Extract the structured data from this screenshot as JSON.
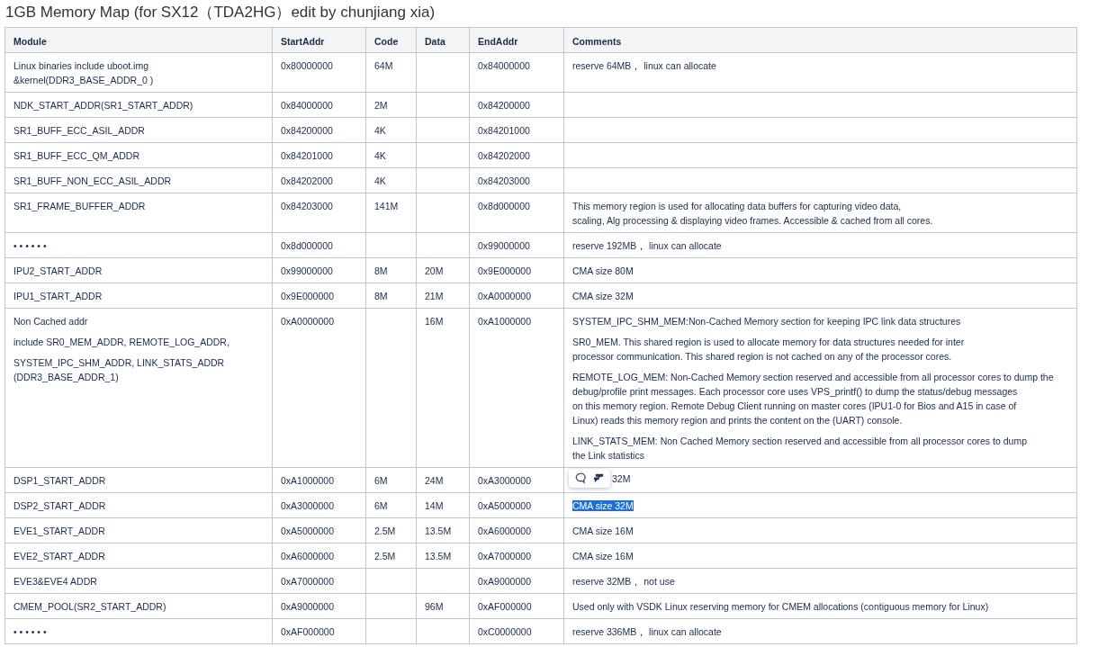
{
  "title": "1GB Memory Map (for SX12（TDA2HG）edit by chunjiang xia)",
  "table": {
    "columns": [
      "Module",
      "StartAddr",
      "Code",
      "Data",
      "EndAddr",
      "Comments"
    ],
    "rows": [
      {
        "module": [
          "Linux binaries include uboot.img\n&kernel(DDR3_BASE_ADDR_0 )"
        ],
        "start": "0x80000000",
        "code": "64M",
        "end": "0x84000000",
        "comment": [
          "reserve 64MB， linux can allocate"
        ],
        "comment_selected": false,
        "toolbar_shown": false
      },
      {
        "module": [
          "NDK_START_ADDR(SR1_START_ADDR)"
        ],
        "start": "0x84000000",
        "code": "2M",
        "end": "0x84200000",
        "comment_selected": false,
        "toolbar_shown": false
      },
      {
        "module": [
          "SR1_BUFF_ECC_ASIL_ADDR"
        ],
        "start": "0x84200000",
        "code": "4K",
        "end": "0x84201000",
        "comment_selected": false,
        "toolbar_shown": false
      },
      {
        "module": [
          "SR1_BUFF_ECC_QM_ADDR"
        ],
        "start": "0x84201000",
        "code": "4K",
        "end": "0x84202000",
        "comment_selected": false,
        "toolbar_shown": false
      },
      {
        "module": [
          "SR1_BUFF_NON_ECC_ASIL_ADDR"
        ],
        "start": "0x84202000",
        "code": "4K",
        "end": "0x84203000",
        "comment_selected": false,
        "toolbar_shown": false
      },
      {
        "module": [
          "SR1_FRAME_BUFFER_ADDR"
        ],
        "start": "0x84203000",
        "code": "141M",
        "end": "0x8d000000",
        "comment": [
          "This memory region is used for allocating data buffers for capturing video data,\nscaling, Alg processing & displaying video frames. Accessible & cached from all cores."
        ],
        "comment_selected": false,
        "toolbar_shown": false
      },
      {
        "module": [
          "• • • • • •"
        ],
        "start": "0x8d000000",
        "end": "0x99000000",
        "comment": [
          "reserve 192MB， linux can allocate"
        ],
        "comment_selected": false,
        "toolbar_shown": false
      },
      {
        "module": [
          "IPU2_START_ADDR"
        ],
        "start": "0x99000000",
        "code": "8M",
        "data": "20M",
        "end": "0x9E000000",
        "comment": [
          "CMA size 80M"
        ],
        "comment_selected": false,
        "toolbar_shown": false
      },
      {
        "module": [
          "IPU1_START_ADDR"
        ],
        "start": "0x9E000000",
        "code": "8M",
        "data": "21M",
        "end": "0xA0000000",
        "comment": [
          "CMA size 32M"
        ],
        "comment_selected": false,
        "toolbar_shown": false
      },
      {
        "module": [
          "Non Cached addr",
          "include SR0_MEM_ADDR, REMOTE_LOG_ADDR,",
          "SYSTEM_IPC_SHM_ADDR, LINK_STATS_ADDR\n(DDR3_BASE_ADDR_1)"
        ],
        "start": "0xA0000000",
        "data": "16M",
        "end": "0xA1000000",
        "comment": [
          "SYSTEM_IPC_SHM_MEM:Non-Cached Memory section for keeping IPC link data structures",
          "SR0_MEM. This shared region is used to allocate memory for data structures needed for inter\nprocessor communication. This shared region is not cached on any of the processor cores.",
          "REMOTE_LOG_MEM: Non-Cached Memory section reserved and accessible from all processor cores to dump the\ndebug/profile print messages. Each processor core uses VPS_printf() to dump the status/debug messages\non this memory region. Remote Debug Client running on master cores (IPU1-0 for Bios and A15 in case of\nLinux) reads this memory region and prints the content on the (UART) console.",
          "LINK_STATS_MEM: Non Cached Memory section reserved and accessible from all processor cores to dump\nthe Link statistics"
        ],
        "comment_selected": false,
        "toolbar_shown": false
      },
      {
        "module": [
          "DSP1_START_ADDR"
        ],
        "start": "0xA1000000",
        "code": "6M",
        "data": "24M",
        "end": "0xA3000000",
        "comment": [
          "32M"
        ],
        "comment_selected": false,
        "toolbar_shown": true
      },
      {
        "module": [
          "DSP2_START_ADDR"
        ],
        "start": "0xA3000000",
        "code": "6M",
        "data": "14M",
        "end": "0xA5000000",
        "comment": [
          "CMA size 32M"
        ],
        "comment_selected": true,
        "toolbar_shown": false
      },
      {
        "module": [
          "EVE1_START_ADDR"
        ],
        "start": "0xA5000000",
        "code": "2.5M",
        "data": "13.5M",
        "end": "0xA6000000",
        "comment": [
          "CMA size 16M"
        ],
        "comment_selected": false,
        "toolbar_shown": false
      },
      {
        "module": [
          "EVE2_START_ADDR"
        ],
        "start": "0xA6000000",
        "code": "2.5M",
        "data": "13.5M",
        "end": "0xA7000000",
        "comment": [
          "CMA size 16M"
        ],
        "comment_selected": false,
        "toolbar_shown": false
      },
      {
        "module": [
          "EVE3&EVE4 ADDR"
        ],
        "start": "0xA7000000",
        "end": "0xA9000000",
        "comment": [
          "reserve 32MB， not use"
        ],
        "comment_selected": false,
        "toolbar_shown": false
      },
      {
        "module": [
          "CMEM_POOL(SR2_START_ADDR)"
        ],
        "start": "0xA9000000",
        "data": "96M",
        "end": "0xAF000000",
        "comment": [
          " Used only with VSDK Linux reserving memory for CMEM allocations (contiguous memory for Linux)"
        ],
        "comment_selected": false,
        "toolbar_shown": false
      },
      {
        "module": [
          "• • • • • •"
        ],
        "start": "0xAF000000",
        "end": "0xC0000000",
        "comment": [
          "reserve 336MB， linux can allocate"
        ],
        "comment_selected": false,
        "toolbar_shown": false
      }
    ]
  }
}
